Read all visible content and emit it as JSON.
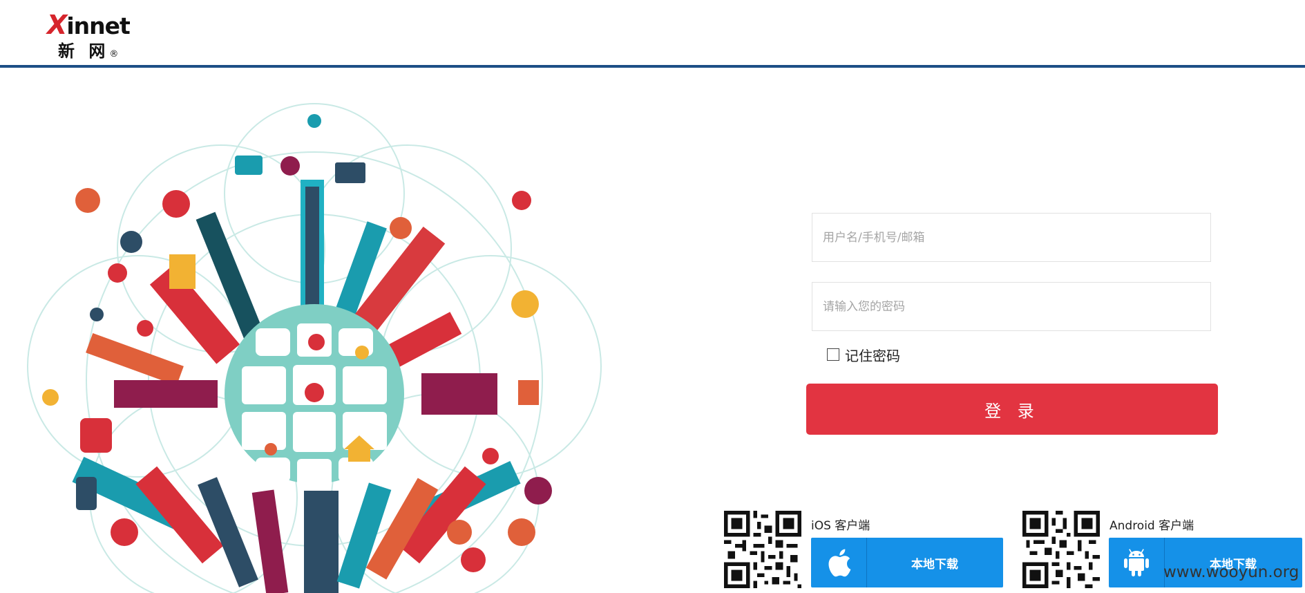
{
  "header": {
    "logo_en_x": "X",
    "logo_en_rest": "innet",
    "logo_cn": "新 网",
    "logo_reg": "®"
  },
  "illustration": {
    "description_icon": "city-globe-illustration"
  },
  "login": {
    "username_placeholder": "用户名/手机号/邮箱",
    "password_placeholder": "请输入您的密码",
    "remember_label": "记住密码",
    "login_button": "登 录"
  },
  "downloads": {
    "ios_title": "iOS 客户端",
    "ios_button": "本地下载",
    "android_title": "Android 客户端",
    "android_button": "本地下载"
  },
  "watermark": "www.wooyun.org",
  "colors": {
    "header_line": "#1c4f86",
    "login_button": "#e23441",
    "download_button": "#1591e8"
  }
}
